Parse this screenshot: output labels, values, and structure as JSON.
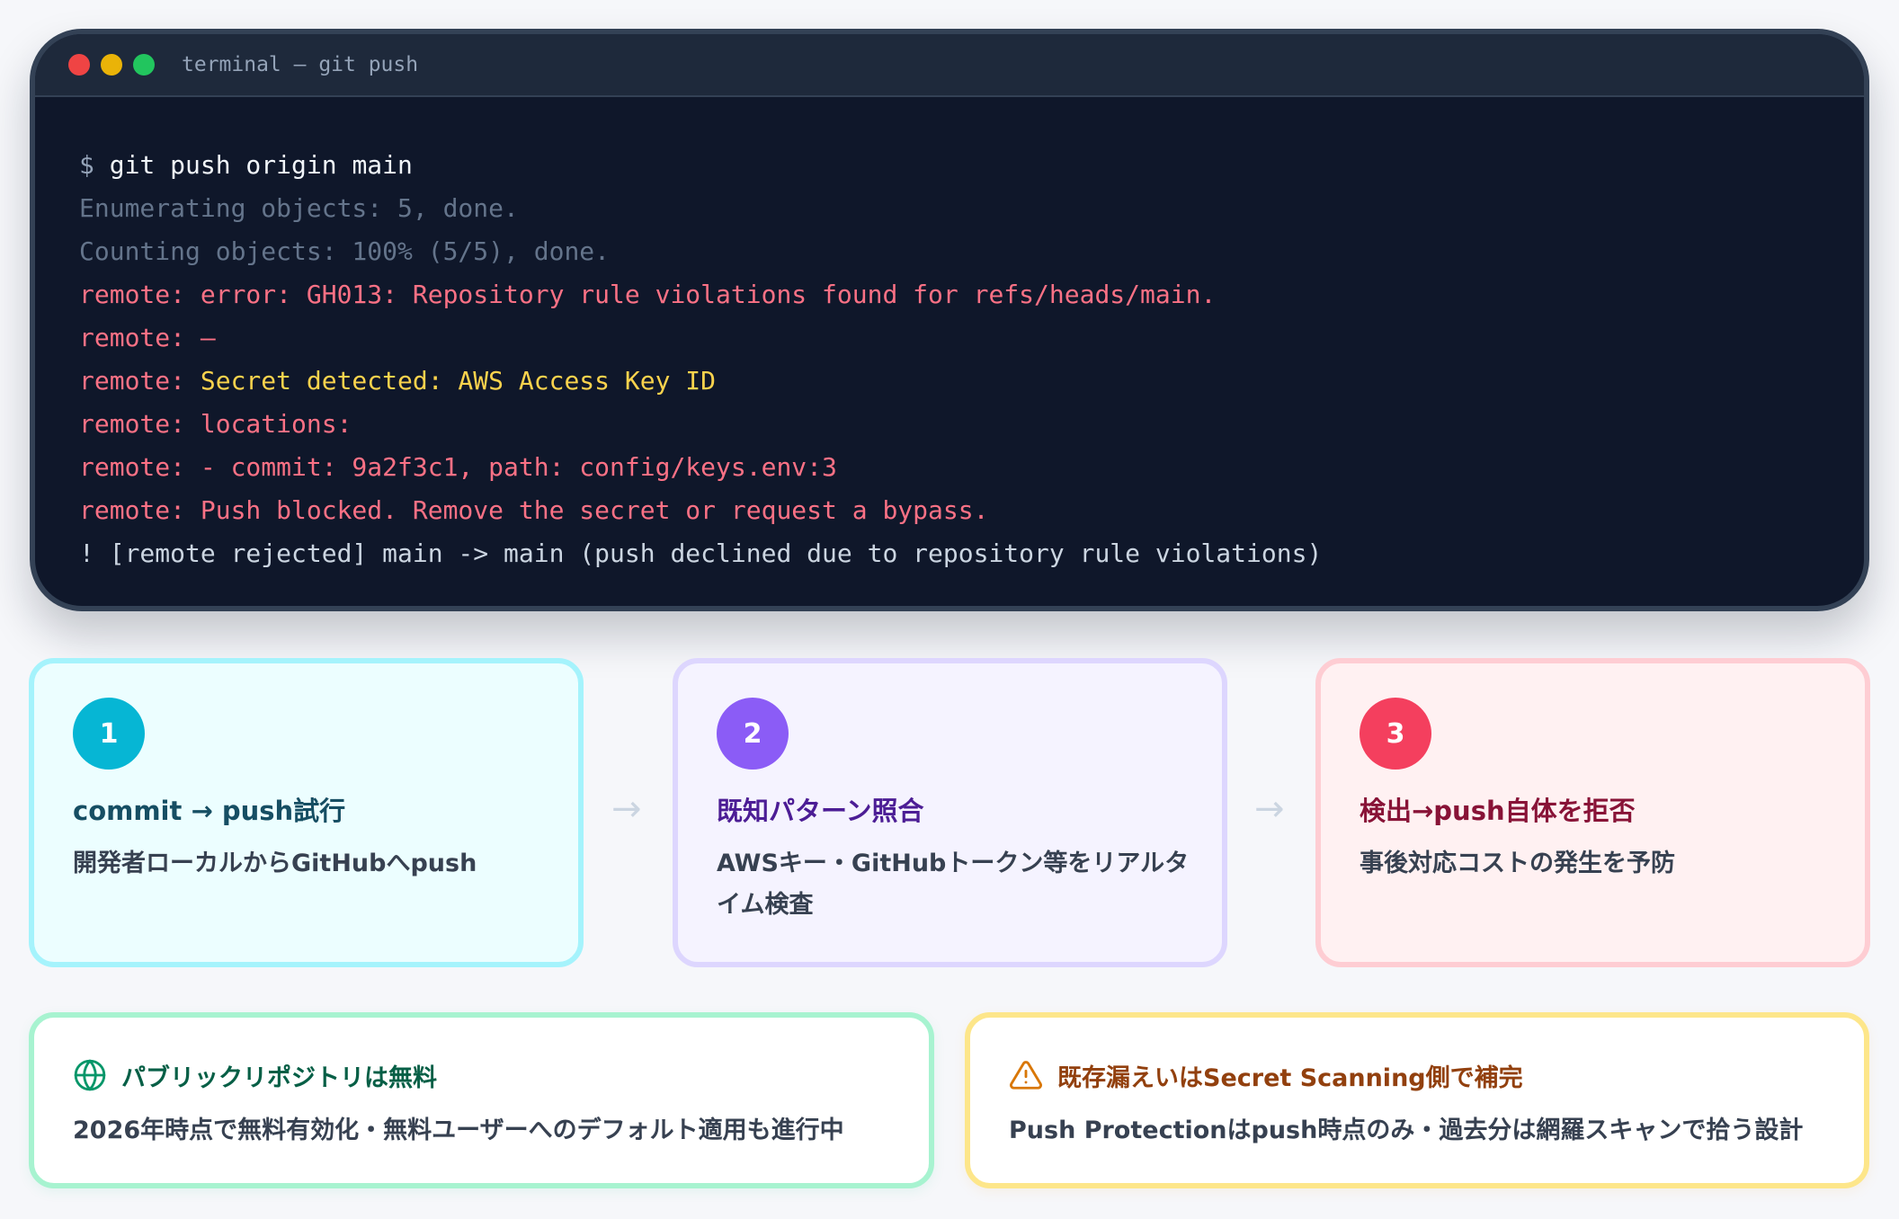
{
  "terminal": {
    "title": "terminal — git push",
    "prompt_symbol": "$",
    "command": "git push origin main",
    "lines": {
      "enumerating": "Enumerating objects: 5, done.",
      "counting": "Counting objects: 100% (5/5), done.",
      "error": "remote: error: GH013: Repository rule violations found for refs/heads/main.",
      "sep_prefix": "remote: ",
      "sep": "—",
      "secret_prefix": "remote: ",
      "secret_detected": "Secret detected: AWS Access Key ID",
      "locations": "remote: locations:",
      "commit": "remote: - commit: 9a2f3c1, path: config/keys.env:3",
      "blocked": "remote: Push blocked. Remove the secret or request a bypass.",
      "rejected": "! [remote rejected] main -> main (push declined due to repository rule violations)"
    }
  },
  "steps": [
    {
      "number": "1",
      "title": "commit → push試行",
      "desc": "開発者ローカルからGitHubへpush"
    },
    {
      "number": "2",
      "title": "既知パターン照合",
      "desc": "AWSキー・GitHubトークン等をリアルタイム検査"
    },
    {
      "number": "3",
      "title": "検出→push自体を拒否",
      "desc": "事後対応コストの発生を予防"
    }
  ],
  "arrow": "→",
  "info": {
    "public": {
      "icon": "globe-icon",
      "title": "パブリックリポジトリは無料",
      "desc": "2026年時点で無料有効化・無料ユーザーへのデフォルト適用も進行中"
    },
    "existing": {
      "icon": "warning-icon",
      "title": "既存漏えいはSecret Scanning側で補完",
      "desc": "Push Protectionはpush時点のみ・過去分は網羅スキャンで拾う設計"
    }
  },
  "colors": {
    "terminal_bg": "#0f172a",
    "error_text": "#fb7185",
    "secret_text": "#fcd34d",
    "step1": "#06b6d4",
    "step2": "#8b5cf6",
    "step3": "#f43f5e"
  }
}
